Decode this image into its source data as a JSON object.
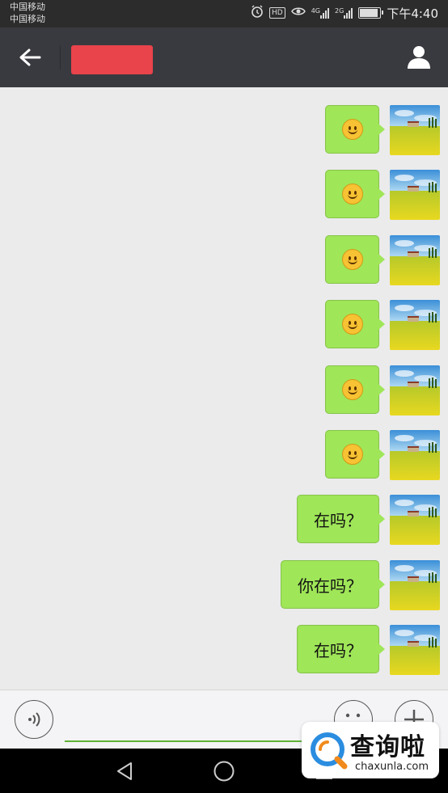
{
  "status_bar": {
    "carrier_1": "中国移动",
    "carrier_2": "中国移动",
    "time": "下午4:40",
    "icons": [
      "alarm-icon",
      "hd-icon",
      "eye-icon",
      "signal-4g-icon",
      "signal-2g-icon",
      "battery-icon"
    ],
    "hd_label": "HD",
    "network_1": "4G",
    "network_2": "2G"
  },
  "header": {
    "back_icon": "arrow-left-icon",
    "contact_name_redacted": true,
    "profile_icon": "person-icon"
  },
  "messages": [
    {
      "type": "emoji",
      "icon": "smiley-emoji",
      "sender": "self"
    },
    {
      "type": "emoji",
      "icon": "smiley-emoji",
      "sender": "self"
    },
    {
      "type": "emoji",
      "icon": "smiley-emoji",
      "sender": "self"
    },
    {
      "type": "emoji",
      "icon": "smiley-emoji",
      "sender": "self"
    },
    {
      "type": "emoji",
      "icon": "smiley-emoji",
      "sender": "self"
    },
    {
      "type": "emoji",
      "icon": "smiley-emoji",
      "sender": "self"
    },
    {
      "type": "text",
      "text": "在吗？",
      "sender": "self"
    },
    {
      "type": "text",
      "text": "你在吗？",
      "sender": "self"
    },
    {
      "type": "text",
      "text": "在吗？",
      "sender": "self"
    }
  ],
  "input_bar": {
    "voice_icon": "voice-icon",
    "input_value": "",
    "emoji_icon": "emoji-icon",
    "more_icon": "plus-icon"
  },
  "watermark": {
    "text": "查询啦",
    "subtext": "chaxunla.com"
  },
  "system_nav": {
    "icons": [
      "back-triangle-icon",
      "home-circle-icon",
      "recents-square-icon"
    ]
  },
  "colors": {
    "bubble": "#9fe658",
    "nav_bar": "#393a3f",
    "redaction": "#e9434b",
    "chat_bg": "#ebebeb"
  }
}
